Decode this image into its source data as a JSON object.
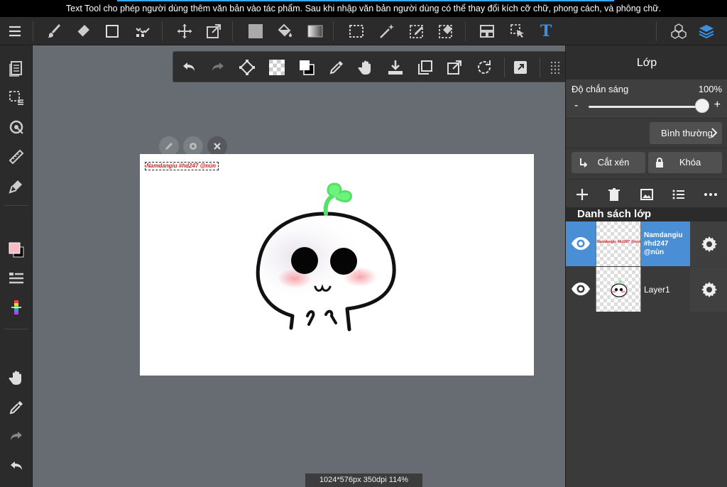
{
  "caption": {
    "text": "Text Tool cho phép người dùng thêm văn bản vào tác phẩm. Sau khi nhập văn bản người dùng có thể thay đổi kích cỡ chữ, phong cách, và phông chữ."
  },
  "toolbar": {
    "icons": [
      "menu-icon",
      "brush-icon",
      "eraser-icon",
      "rectangle-icon",
      "dot-icon",
      "move-icon",
      "transform-icon",
      "fill-square-icon",
      "bucket-icon",
      "gradient-icon",
      "select-rect-icon",
      "magic-wand-icon",
      "select-pen-icon",
      "select-eraser-icon",
      "frame-divider-icon",
      "operation-icon",
      "text-icon",
      "materials-icon",
      "layers-icon"
    ],
    "text_tool_glyph": "T",
    "accent_color": "#3d8fe0"
  },
  "floating_toolbar": {
    "icons": [
      "undo-icon",
      "redo-icon",
      "transform-icon",
      "transparent-icon",
      "color-swap-icon",
      "eyedropper-icon",
      "hand-icon",
      "save-icon",
      "duplicate-icon",
      "export-icon",
      "rotate-icon",
      "external-icon",
      "grip-icon"
    ]
  },
  "left_toolbar": {
    "icons": [
      "layer-sheet-icon",
      "select-list-icon",
      "snap-icon",
      "ruler-icon",
      "brush-marker-icon",
      "color-icon",
      "brush-list-icon",
      "palette-icon",
      "hand-icon",
      "eyedropper-icon",
      "redo-icon",
      "undo-icon"
    ],
    "foreground_color": "#f7bcc6",
    "background_color": "#000000"
  },
  "canvas": {
    "text_layer_content": "Namdangiu #hd247 @nùn",
    "text_color": "#e02020"
  },
  "status_bar": {
    "text": "1024*576px 350dpi 114%"
  },
  "layer_panel": {
    "title": "Lớp",
    "opacity": {
      "label": "Độ chắn sáng",
      "value_text": "100%",
      "value": 1.0,
      "minus": "-",
      "plus": "+"
    },
    "blend_mode": "Bình thường",
    "clipping_label": "Cắt xén",
    "lock_label": "Khóa",
    "list_title": "Danh sách lớp",
    "selected_color": "#4a8ed6",
    "layers": [
      {
        "name": "Namdangiu #hd247 @nùn",
        "thumb_text": "Namdangiu #hd247 @nùn",
        "selected": true
      },
      {
        "name": "Layer1",
        "selected": false
      }
    ]
  }
}
